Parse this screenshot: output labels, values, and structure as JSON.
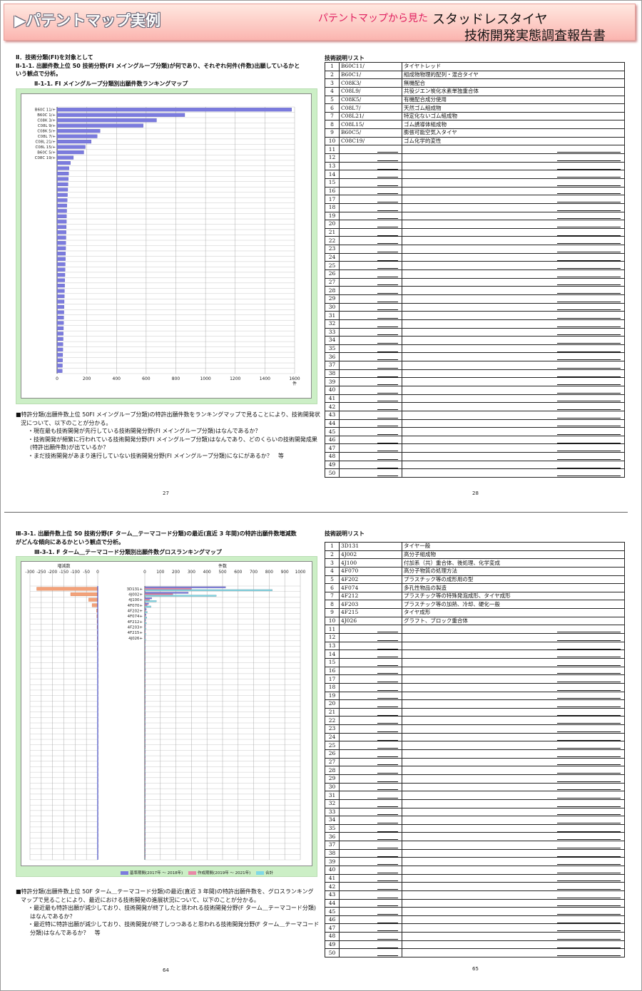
{
  "banner": {
    "title": "パテントマップ実例",
    "subtitle_pink": "パテントマップから見た",
    "subtitle_main": "スタッドレスタイヤ",
    "subtitle_report": "技術開発実態調査報告書"
  },
  "top": {
    "heading1": "Ⅱ．技術分類(FI)を対象として",
    "heading2": "Ⅱ-1-1. 出願件数上位 50 技術分野(FI メイングループ分類)が何であり、それぞれ何件(件数)出願しているかと",
    "heading2b": "いう観点で分析。",
    "heading3": "Ⅱ-1-1. FI メイングループ分類別出願件数ランキングマップ",
    "para_lines": [
      "■特許分類(出願件数上位 50FI メイングループ分類)の特許出願件数をランキングマップで見ることにより、技術開発状",
      "況について、以下のことが分かる。",
      "・現在最も技術開発が先行している技術開発分野(FI メイングループ分類)はなんであるか？",
      "・技術開発が頻繁に行われている技術開発分野(FI メイングループ分類)はなんであり、どのくらいの技術開発成果",
      "(特許出願件数)が出ているか？",
      "・まだ技術開発があまり進行していない技術開発分野(FI メイングループ分類)になにがあるか？　等"
    ],
    "page_left": "27",
    "page_right": "28",
    "list_title": "技術説明リスト",
    "list": [
      {
        "no": "1",
        "code": "B60C11/",
        "desc": "タイヤトレッド"
      },
      {
        "no": "2",
        "code": "B60C1/",
        "desc": "組成物物理的配列・混合タイヤ"
      },
      {
        "no": "3",
        "code": "C08K3/",
        "desc": "無機配合"
      },
      {
        "no": "4",
        "code": "C08L9/",
        "desc": "共役ジエン炭化水素単独重合体"
      },
      {
        "no": "5",
        "code": "C08K5/",
        "desc": "有機配合成分使用"
      },
      {
        "no": "6",
        "code": "C08L7/",
        "desc": "天然ゴム組成物"
      },
      {
        "no": "7",
        "code": "C08L21/",
        "desc": "特定化ないゴム組成物"
      },
      {
        "no": "8",
        "code": "C08L15/",
        "desc": "ゴム誘導体組成物"
      },
      {
        "no": "9",
        "code": "B60C5/",
        "desc": "膨張可能空気入タイヤ"
      },
      {
        "no": "10",
        "code": "C08C19/",
        "desc": "ゴム化学的変性"
      }
    ]
  },
  "bottom": {
    "heading1": "Ⅲ-3-1. 出願件数上位 50 技術分野(F ターム＿テーマコード分類)の最近(直近 3 年間)の特許出願件数増減数",
    "heading1b": "がどんな傾向にあるかという観点で分析。",
    "heading2": "Ⅲ-3-1. F ターム＿テーマコード分類別出願件数グロスランキングマップ",
    "para_lines": [
      "■特許分類(出願件数上位 50F ターム＿テーマコード分類)の最近(直近 3 年間)の特許出願件数を、グロスランキング",
      "マップで見ることにより、最近における技術開発の進展状況について、以下のことが分かる。",
      "・最近最も特許出願が減少しており、技術開発が終了したと思われる技術開発分野(F ターム＿テーマコード分類)",
      "はなんであるか？",
      "・最近特に特許出願が減少しており、技術開発が終了しつつあると思われる技術開発分野(F ターム＿テーマコード",
      "分類)はなんであるか？　等"
    ],
    "page_left": "64",
    "page_right": "65",
    "list_title": "技術説明リスト",
    "list": [
      {
        "no": "1",
        "code": "3D131",
        "desc": "タイヤ一般"
      },
      {
        "no": "2",
        "code": "4J002",
        "desc": "高分子組成物"
      },
      {
        "no": "3",
        "code": "4J100",
        "desc": "付加系（共）重合体、後処理、化学変成"
      },
      {
        "no": "4",
        "code": "4F070",
        "desc": "高分子物質の処理方法"
      },
      {
        "no": "5",
        "code": "4F202",
        "desc": "プラスチック等の成形用の型"
      },
      {
        "no": "6",
        "code": "4F074",
        "desc": "多孔性物品の製造"
      },
      {
        "no": "7",
        "code": "4F212",
        "desc": "プラスチック等の特殊発泡成形、タイヤ成形"
      },
      {
        "no": "8",
        "code": "4F203",
        "desc": "プラスチック等の加熱、冷却、硬化一般"
      },
      {
        "no": "9",
        "code": "4F215",
        "desc": "タイヤ成形"
      },
      {
        "no": "10",
        "code": "4J026",
        "desc": "グラフト、ブロック重合体"
      }
    ]
  },
  "chart_data": [
    {
      "type": "bar",
      "orientation": "horizontal",
      "xlabel": "件",
      "xlim": [
        0,
        1600
      ],
      "xticks": [
        0,
        200,
        400,
        600,
        800,
        1000,
        1200,
        1400,
        1600
      ],
      "categories": [
        "B60C 11/+",
        "B60C 1/+",
        "C08K 3/+",
        "C08L 9/+",
        "C08K 5/+",
        "C08L 7/+",
        "C08L 21/+",
        "C08L 15/+",
        "B60C 5/+",
        "C08C 19/+"
      ],
      "values": [
        1580,
        860,
        670,
        580,
        290,
        270,
        230,
        190,
        180,
        110,
        90,
        80,
        78,
        76,
        74,
        72,
        70,
        68,
        66,
        65,
        64,
        63,
        62,
        61,
        60,
        59,
        58,
        57,
        56,
        55,
        54,
        53,
        52,
        51,
        50,
        49,
        48,
        47,
        46,
        45,
        44,
        43,
        42,
        41,
        40,
        39,
        38,
        37,
        36,
        35
      ],
      "color": "#7b7bde",
      "grid": true
    },
    {
      "type": "bar",
      "orientation": "horizontal",
      "left_axis_label": "増減数",
      "left_xlim": [
        -300,
        0
      ],
      "left_xticks": [
        -300,
        -250,
        -200,
        -150,
        -100,
        -50,
        0
      ],
      "right_axis_label": "件数",
      "right_xlim": [
        0,
        1000
      ],
      "right_xticks": [
        0,
        100,
        200,
        300,
        400,
        500,
        600,
        700,
        800,
        900,
        1000
      ],
      "categories": [
        "3D131+",
        "4J002+",
        "4J100+",
        "4F070+",
        "4F202+",
        "4F074+",
        "4F212+",
        "4F203+",
        "4F215+",
        "4J026+"
      ],
      "change": [
        -270,
        -120,
        -40,
        -25,
        -5,
        -4,
        -3,
        -3,
        -2,
        -2,
        -2,
        -2,
        -1,
        -1,
        -1,
        -1,
        -1,
        -1,
        -1,
        -1,
        -1,
        -1,
        -1,
        -1,
        -1,
        -1,
        -1,
        -1,
        -1,
        -1,
        -1,
        -1,
        -1,
        -1,
        -1,
        -1,
        -1,
        -1,
        -1,
        -1,
        -1,
        -1,
        -1,
        -1,
        -1,
        -1,
        -1,
        -1,
        -1,
        -1
      ],
      "series": [
        {
          "name": "基準期間(2017年 ～ 2018年)",
          "color": "#7b7bde",
          "values": [
            520,
            280,
            45,
            25,
            10,
            8,
            6,
            5,
            4,
            4
          ]
        },
        {
          "name": "作成期間(2019年 ～ 2021年)",
          "color": "#e889a8",
          "values": [
            300,
            180,
            30,
            15,
            6,
            5,
            4,
            3,
            3,
            2
          ]
        },
        {
          "name": "合計",
          "color": "#7fd9e6",
          "values": [
            820,
            460,
            75,
            40,
            16,
            13,
            10,
            8,
            7,
            6
          ]
        }
      ],
      "legend_position": "bottom",
      "grid": true
    }
  ]
}
